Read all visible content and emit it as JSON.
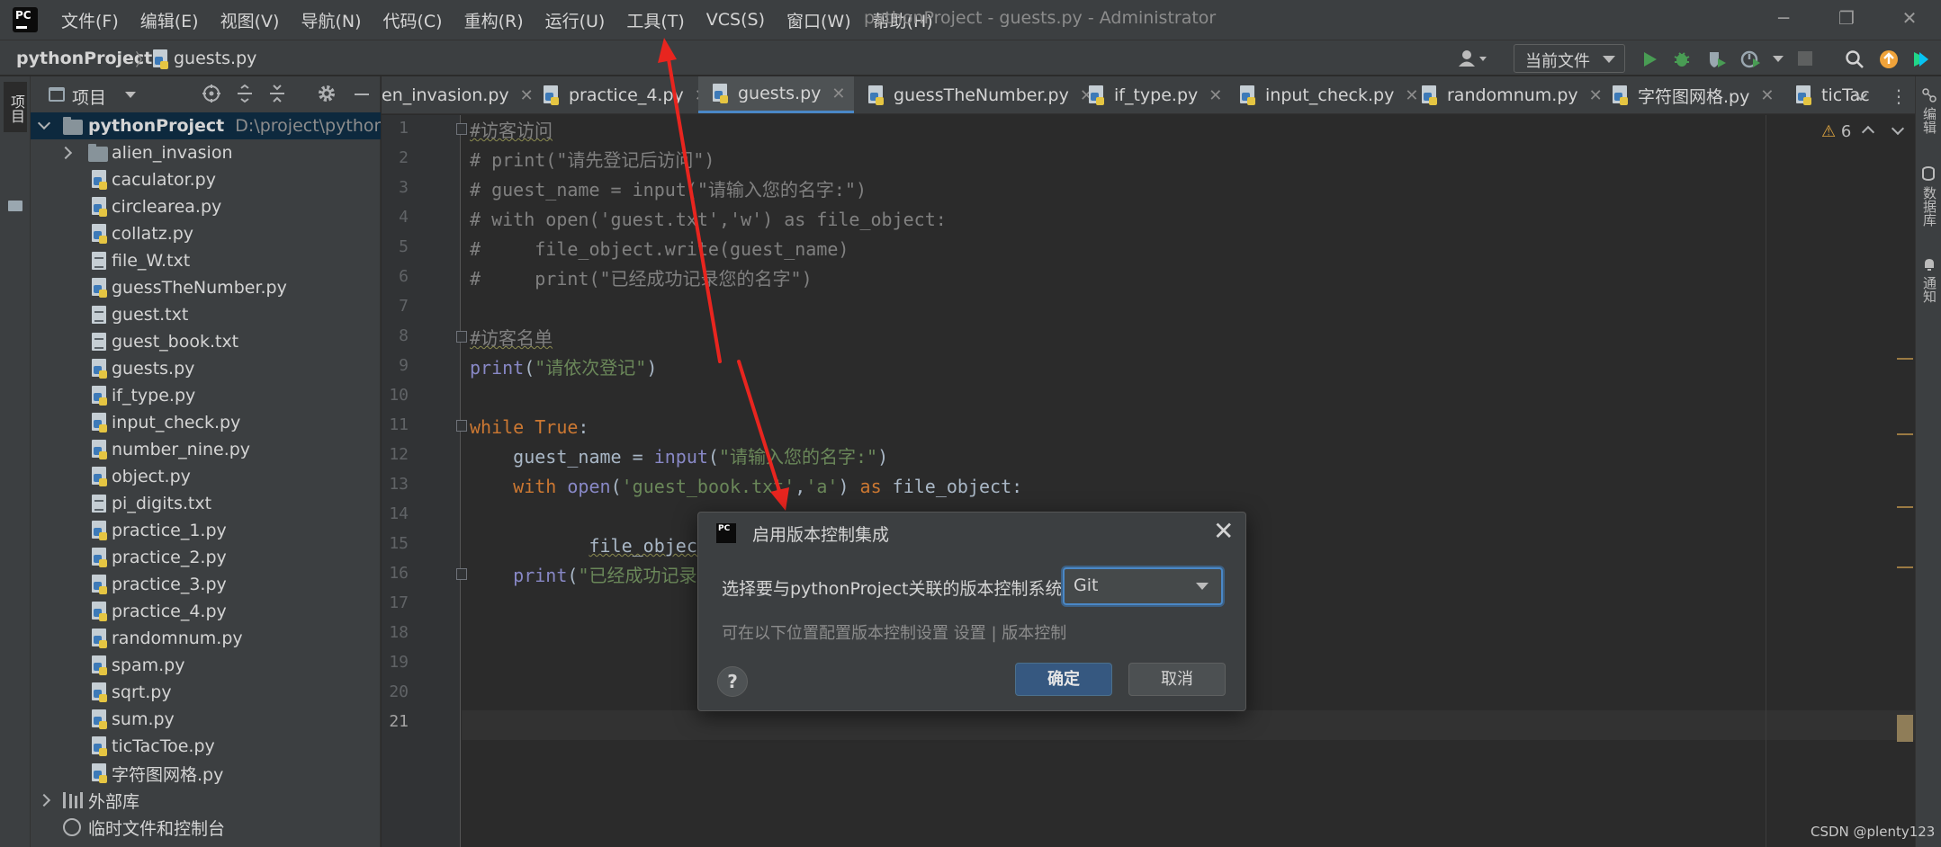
{
  "window": {
    "title": "pythonProject - guests.py - Administrator",
    "minimize_glyph": "─",
    "restore_glyph": "❐",
    "close_glyph": "✕"
  },
  "menu": [
    "文件(F)",
    "编辑(E)",
    "视图(V)",
    "导航(N)",
    "代码(C)",
    "重构(R)",
    "运行(U)",
    "工具(T)",
    "VCS(S)",
    "窗口(W)",
    "帮助(H)"
  ],
  "navbar": {
    "project": "pythonProject",
    "separator": "〉",
    "file": "guests.py",
    "run_config": "当前文件"
  },
  "left_strip": {
    "project_label": "项目"
  },
  "right_strip": [
    "编辑",
    "数据库",
    "通知"
  ],
  "project_panel": {
    "title": "项目",
    "root_name": "pythonProject",
    "root_path": "D:\\project\\pythonProj",
    "folders": [
      "alien_invasion"
    ],
    "files": [
      {
        "name": "caculator.py",
        "type": "py"
      },
      {
        "name": "circlearea.py",
        "type": "py"
      },
      {
        "name": "collatz.py",
        "type": "py"
      },
      {
        "name": "file_W.txt",
        "type": "txt"
      },
      {
        "name": "guessTheNumber.py",
        "type": "py"
      },
      {
        "name": "guest.txt",
        "type": "txt"
      },
      {
        "name": "guest_book.txt",
        "type": "txt"
      },
      {
        "name": "guests.py",
        "type": "py"
      },
      {
        "name": "if_type.py",
        "type": "py"
      },
      {
        "name": "input_check.py",
        "type": "py"
      },
      {
        "name": "number_nine.py",
        "type": "py"
      },
      {
        "name": "object.py",
        "type": "py"
      },
      {
        "name": "pi_digits.txt",
        "type": "txt"
      },
      {
        "name": "practice_1.py",
        "type": "py"
      },
      {
        "name": "practice_2.py",
        "type": "py"
      },
      {
        "name": "practice_3.py",
        "type": "py"
      },
      {
        "name": "practice_4.py",
        "type": "py"
      },
      {
        "name": "randomnum.py",
        "type": "py"
      },
      {
        "name": "spam.py",
        "type": "py"
      },
      {
        "name": "sqrt.py",
        "type": "py"
      },
      {
        "name": "sum.py",
        "type": "py"
      },
      {
        "name": "ticTacToe.py",
        "type": "py"
      },
      {
        "name": "字符图网格.py",
        "type": "py"
      }
    ],
    "external_libs": "外部库",
    "scratches": "临时文件和控制台"
  },
  "tabs": [
    {
      "label": "en_invasion.py",
      "active": false
    },
    {
      "label": "practice_4.py",
      "active": false
    },
    {
      "label": "guests.py",
      "active": true
    },
    {
      "label": "guessTheNumber.py",
      "active": false
    },
    {
      "label": "if_type.py",
      "active": false
    },
    {
      "label": "input_check.py",
      "active": false
    },
    {
      "label": "randomnum.py",
      "active": false
    },
    {
      "label": "字符图网格.py",
      "active": false
    },
    {
      "label": "ticTac",
      "active": false
    }
  ],
  "editor": {
    "warning_count": "6",
    "current_line": 21,
    "line_count": 21
  },
  "dialog": {
    "title": "启用版本控制集成",
    "label": "选择要与pythonProject关联的版本控制系统:",
    "selected_vcs": "Git",
    "hint": "可在以下位置配置版本控制设置 设置 | 版本控制",
    "help": "?",
    "ok": "确定",
    "cancel": "取消",
    "close_glyph": "✕"
  },
  "watermark": "CSDN @plenty123",
  "colors": {
    "background": "#2b2b2b",
    "panel": "#3c3f41",
    "selection": "#0d293e",
    "accent": "#4a88c7",
    "annotation_arrow": "#e8251f"
  }
}
